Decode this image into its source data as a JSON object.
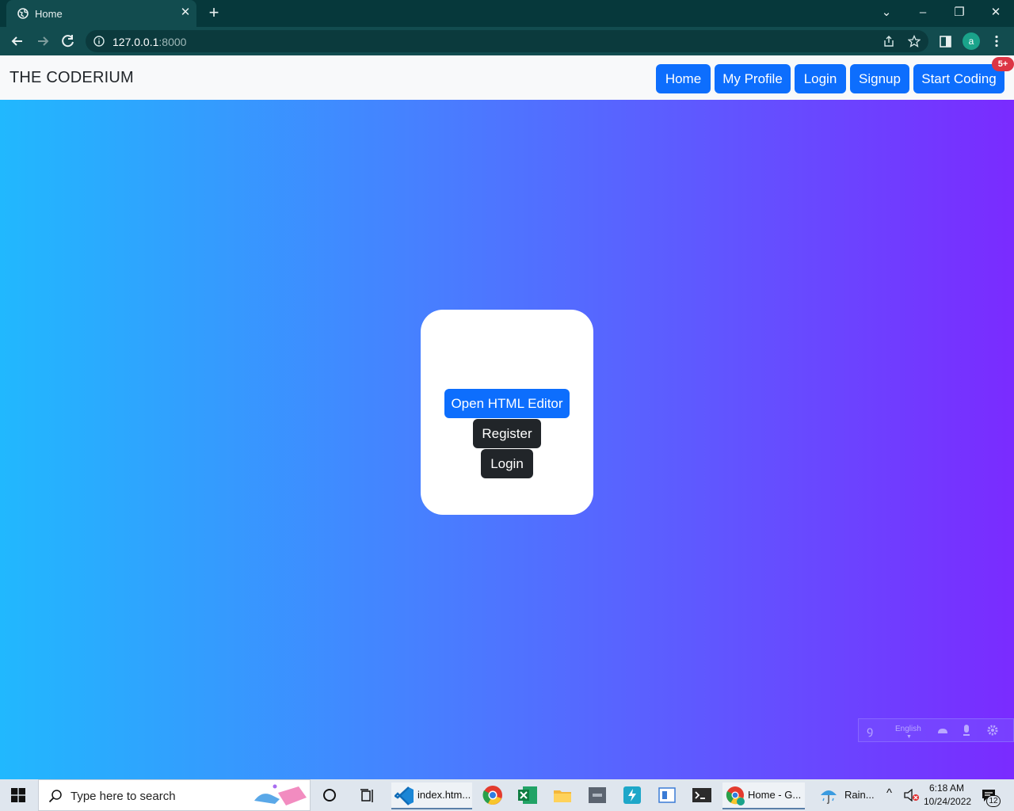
{
  "browser": {
    "tab_title": "Home",
    "url_host": "127.0.0.1",
    "url_port": ":8000",
    "profile_initial": "a"
  },
  "site": {
    "brand": "THE CODERIUM",
    "nav": [
      "Home",
      "My Profile",
      "Login",
      "Signup",
      "Start Coding"
    ],
    "badge": "5+",
    "card": {
      "open_editor": "Open HTML Editor",
      "register": "Register",
      "login": "Login"
    },
    "language": "English"
  },
  "taskbar": {
    "search_placeholder": "Type here to search",
    "vscode_label": "index.htm...",
    "chrome_label": "Home - G...",
    "weather_label": "Rain...",
    "time": "6:18 AM",
    "date": "10/24/2022",
    "notifications": "12"
  },
  "colors": {
    "primary": "#0d6efd",
    "dark": "#212529",
    "danger": "#dc3545",
    "gradient_start": "#21b8fe",
    "gradient_end": "#7a2bff"
  }
}
